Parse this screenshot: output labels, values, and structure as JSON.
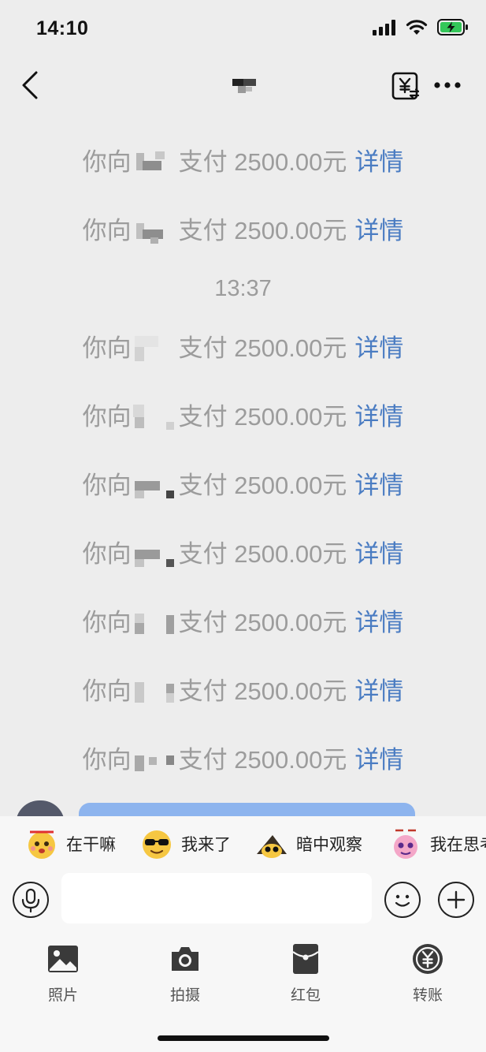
{
  "status_bar": {
    "time": "14:10"
  },
  "nav": {
    "title": ""
  },
  "messages": [
    {
      "prefix": "你向",
      "suffix": "支付 2500.00元",
      "link": "详情"
    },
    {
      "prefix": "你向",
      "suffix": "支付 2500.00元",
      "link": "详情"
    },
    {
      "type": "time",
      "text": "13:37"
    },
    {
      "prefix": "你向",
      "suffix": "支付 2500.00元",
      "link": "详情"
    },
    {
      "prefix": "你向",
      "suffix": "支付 2500.00元",
      "link": "详情"
    },
    {
      "prefix": "你向",
      "suffix": "支付 2500.00元",
      "link": "详情"
    },
    {
      "prefix": "你向",
      "suffix": "支付 2500.00元",
      "link": "详情"
    },
    {
      "prefix": "你向",
      "suffix": "支付 2500.00元",
      "link": "详情"
    },
    {
      "prefix": "你向",
      "suffix": "支付 2500.00元",
      "link": "详情"
    },
    {
      "prefix": "你向",
      "suffix": "支付 2500.00元",
      "link": "详情"
    }
  ],
  "stickers": [
    {
      "label": "在干嘛",
      "icon": "face-sticker-icon"
    },
    {
      "label": "我来了",
      "icon": "sunglasses-face-sticker-icon"
    },
    {
      "label": "暗中观察",
      "icon": "peeking-face-sticker-icon"
    },
    {
      "label": "我在思考",
      "icon": "thinking-face-sticker-icon"
    }
  ],
  "input": {
    "placeholder": ""
  },
  "actions": [
    {
      "label": "照片",
      "icon": "photo-icon"
    },
    {
      "label": "拍摄",
      "icon": "camera-icon"
    },
    {
      "label": "红包",
      "icon": "red-packet-icon"
    },
    {
      "label": "转账",
      "icon": "transfer-icon"
    }
  ],
  "colors": {
    "link": "#4a7cc2",
    "system_text": "#9c9c9c",
    "background": "#ededed",
    "bubble": "#8db4ee"
  }
}
